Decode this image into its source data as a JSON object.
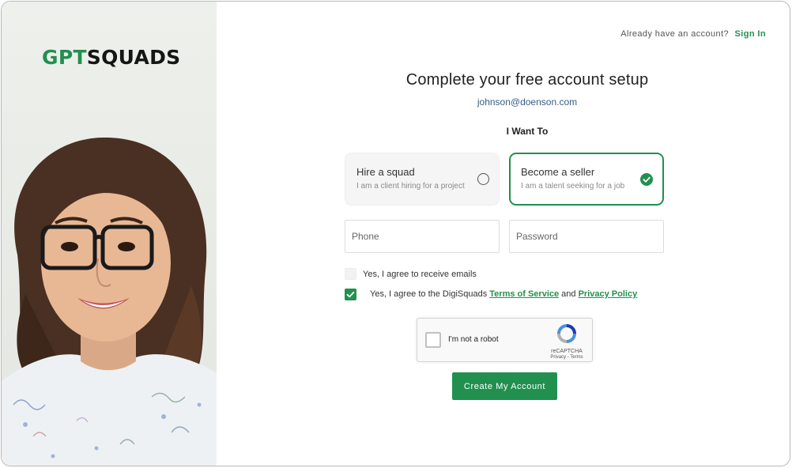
{
  "brand": {
    "logo_part1": "GPT",
    "logo_part2": "SQUADS",
    "accent_color": "#21904f"
  },
  "header": {
    "prompt": "Already have an account?",
    "signin_label": "Sign In"
  },
  "main": {
    "title": "Complete your free account setup",
    "email": "johnson@doenson.com",
    "want_label": "I Want To"
  },
  "roles": {
    "hire": {
      "title": "Hire a squad",
      "subtitle": "I am a client hiring for a project",
      "selected": false
    },
    "seller": {
      "title": "Become a seller",
      "subtitle": "I am a talent seeking for a job",
      "selected": true
    }
  },
  "form": {
    "phone_placeholder": "Phone",
    "password_placeholder": "Password",
    "agree_emails": {
      "label": "Yes, I agree to receive emails",
      "checked": false
    },
    "agree_terms": {
      "prefix": "Yes, I agree to the DigiSquads",
      "terms_link": "Terms of Service",
      "and": "and",
      "privacy_link": "Privacy Policy",
      "checked": true
    }
  },
  "captcha": {
    "label": "I'm not a robot",
    "brand": "reCAPTCHA",
    "terms": "Privacy - Terms"
  },
  "submit_label": "Create My Account"
}
